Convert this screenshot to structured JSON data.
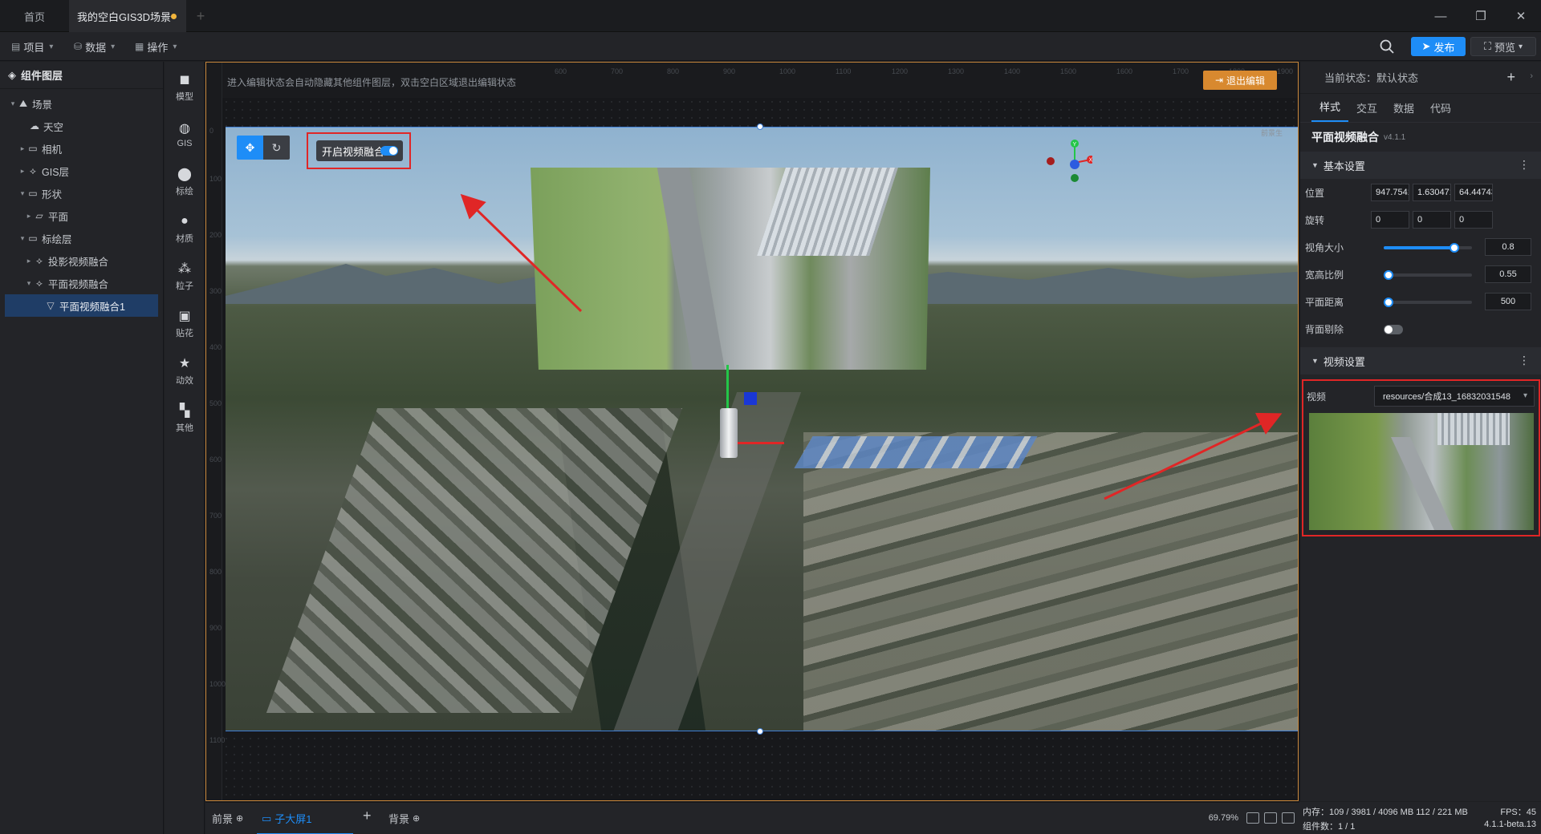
{
  "tabs": {
    "home": "首页",
    "scene": "我的空白GIS3D场景"
  },
  "menus": {
    "project": "项目",
    "data": "数据",
    "operate": "操作"
  },
  "toolbar": {
    "publish": "发布",
    "preview": "预览"
  },
  "layers": {
    "title": "组件图层",
    "items": [
      {
        "label": "场景"
      },
      {
        "label": "天空"
      },
      {
        "label": "相机"
      },
      {
        "label": "GIS层"
      },
      {
        "label": "形状"
      },
      {
        "label": "平面"
      },
      {
        "label": "标绘层"
      },
      {
        "label": "投影视频融合"
      },
      {
        "label": "平面视频融合"
      },
      {
        "label": "平面视频融合1"
      }
    ]
  },
  "components": [
    "模型",
    "GIS",
    "标绘",
    "材质",
    "粒子",
    "贴花",
    "动效",
    "其他"
  ],
  "canvas": {
    "hint": "进入编辑状态会自动隐藏其他组件图层，双击空白区域退出编辑状态",
    "exit_edit": "退出编辑",
    "fusion_toggle_label": "开启视频融合",
    "fusion_enabled": true,
    "ruler_top": [
      "600",
      "700",
      "800",
      "900",
      "1000",
      "1100",
      "1200",
      "1300",
      "1400",
      "1500",
      "1600",
      "1700",
      "1800",
      "1900"
    ],
    "ruler_left": [
      "0",
      "100",
      "200",
      "300",
      "400",
      "500",
      "600",
      "700",
      "800",
      "900",
      "1000",
      "1100"
    ],
    "corner_tag": "前景生",
    "gizmo": {
      "y_axis": "Y",
      "x_axis": "X",
      "x_color": "#e02626",
      "y_color": "#23c648",
      "z_color": "#1a37d6"
    }
  },
  "rpanel": {
    "state": "当前状态：默认状态",
    "tabs": [
      "样式",
      "交互",
      "数据",
      "代码"
    ],
    "component_name": "平面视频融合",
    "version": "v4.1.1",
    "basic_section": "基本设置",
    "position": {
      "label": "位置",
      "x": "947.75415",
      "y": "1.6304713",
      "z": "64.447433"
    },
    "rotation": {
      "label": "旋转",
      "x": "0",
      "y": "0",
      "z": "0"
    },
    "fov": {
      "label": "视角大小",
      "value": "0.8",
      "fraction": 0.8
    },
    "aspect": {
      "label": "宽高比例",
      "value": "0.55",
      "fraction": 0.05
    },
    "distance": {
      "label": "平面距离",
      "value": "500",
      "fraction": 0.05
    },
    "backface": {
      "label": "背面剔除",
      "enabled": false
    },
    "video_section": "视频设置",
    "video": {
      "label": "视频",
      "value": "resources/合成13_16832031548"
    }
  },
  "footer": {
    "foreground": "前景",
    "screen": "子大屏1",
    "background": "背景",
    "zoom": "69.79%",
    "memory": "内存：109 / 3981 / 4096 MB  112 / 221 MB",
    "count": "组件数：1 / 1",
    "fps": "FPS：45",
    "build": "4.1.1-beta.13"
  },
  "colors": {
    "accent": "#1e8df7",
    "highlight": "#e02626",
    "edit_frame": "#c8863a"
  }
}
